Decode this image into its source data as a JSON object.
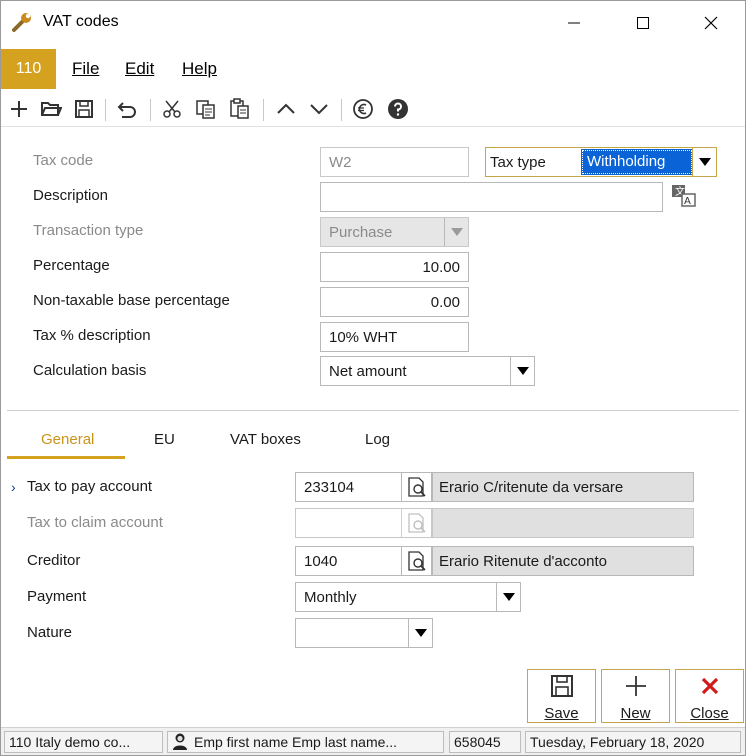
{
  "window": {
    "title": "VAT codes"
  },
  "menu": {
    "company": "110",
    "file": "File",
    "edit": "Edit",
    "help": "Help"
  },
  "form": {
    "tax_code_label": "Tax code",
    "tax_code_value": "W2",
    "tax_type_label": "Tax type",
    "tax_type_value": "Withholding",
    "description_label": "Description",
    "description_value": "",
    "transaction_type_label": "Transaction type",
    "transaction_type_value": "Purchase",
    "percentage_label": "Percentage",
    "percentage_value": "10.00",
    "nontaxable_label": "Non-taxable base percentage",
    "nontaxable_value": "0.00",
    "taxdesc_label": "Tax % description",
    "taxdesc_value": "10% WHT",
    "calc_label": "Calculation basis",
    "calc_value": "Net amount"
  },
  "tabs": {
    "general": "General",
    "eu": "EU",
    "vat_boxes": "VAT boxes",
    "log": "Log"
  },
  "general": {
    "pay_label": "Tax to pay account",
    "pay_code": "233104",
    "pay_desc": "Erario C/ritenute da versare",
    "claim_label": "Tax to claim account",
    "claim_code": "",
    "claim_desc": "",
    "creditor_label": "Creditor",
    "creditor_code": "1040",
    "creditor_desc": "Erario Ritenute d'acconto",
    "payment_label": "Payment",
    "payment_value": "Monthly",
    "nature_label": "Nature",
    "nature_value": ""
  },
  "buttons": {
    "save": "Save",
    "new": "New",
    "close": "Close"
  },
  "status": {
    "company": "110 Italy demo co...",
    "user": "Emp first name Emp last name...",
    "code": "658045",
    "date": "Tuesday, February 18, 2020"
  },
  "colors": {
    "accent": "#d4a21e",
    "selection": "#0a64d8",
    "close_red": "#d11a1a"
  }
}
